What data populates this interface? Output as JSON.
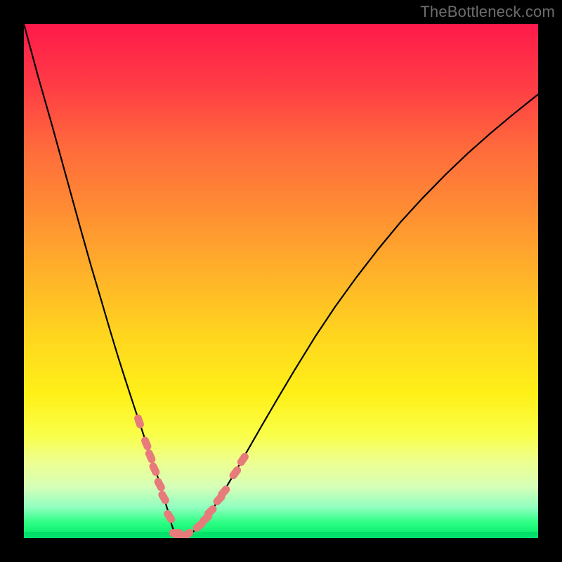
{
  "watermark": "TheBottleneck.com",
  "colors": {
    "frame": "#000000",
    "curve": "#000000",
    "marker_fill": "#e77a7a",
    "marker_stroke": "#d86666"
  },
  "chart_data": {
    "type": "line",
    "title": "",
    "xlabel": "",
    "ylabel": "",
    "xlim": [
      0,
      100
    ],
    "ylim": [
      0,
      100
    ],
    "note": "Axes and ticks are not drawn; values are normalized 0-100 estimates from pixel positions. Y is plotted with 0 at the bottom (inverted from pixel coords).",
    "series": [
      {
        "name": "curve",
        "x": [
          0,
          2.7,
          5.5,
          8.2,
          10.9,
          13.1,
          15.0,
          16.7,
          18.3,
          19.8,
          21.3,
          22.5,
          23.6,
          24.6,
          25.5,
          26.4,
          27.1,
          27.7,
          28.3,
          28.7,
          29.2,
          29.7,
          30.2,
          30.9,
          31.8,
          33.1,
          34.6,
          36.2,
          38.3,
          41.0,
          43.7,
          46.4,
          49.2,
          52.6,
          56.6,
          60.6,
          64.5,
          68.9,
          73.2,
          77.6,
          82.0,
          86.3,
          90.7,
          95.0,
          100.0
        ],
        "y": [
          100.0,
          90.0,
          80.2,
          70.4,
          60.6,
          52.8,
          46.4,
          40.6,
          35.3,
          30.6,
          26.0,
          22.4,
          19.1,
          16.1,
          13.4,
          10.8,
          8.4,
          6.3,
          4.4,
          2.7,
          1.3,
          0.5,
          0.1,
          0.1,
          0.5,
          1.4,
          2.9,
          4.9,
          8.1,
          12.7,
          17.4,
          22.1,
          26.9,
          32.6,
          39.1,
          45.1,
          50.5,
          56.2,
          61.4,
          66.2,
          70.7,
          74.8,
          78.7,
          82.3,
          86.3
        ]
      }
    ],
    "markers": {
      "name": "bottleneck-points",
      "shape": "rounded-pill",
      "x": [
        22.4,
        23.8,
        24.6,
        25.4,
        26.4,
        27.2,
        28.3,
        29.6,
        30.3,
        31.7,
        34.1,
        35.4,
        36.3,
        38.0,
        38.9,
        41.1,
        42.6
      ],
      "y": [
        22.7,
        18.4,
        15.9,
        13.4,
        10.4,
        7.9,
        4.2,
        1.0,
        0.5,
        0.7,
        2.4,
        3.8,
        5.2,
        7.6,
        9.0,
        12.7,
        15.3
      ]
    }
  }
}
